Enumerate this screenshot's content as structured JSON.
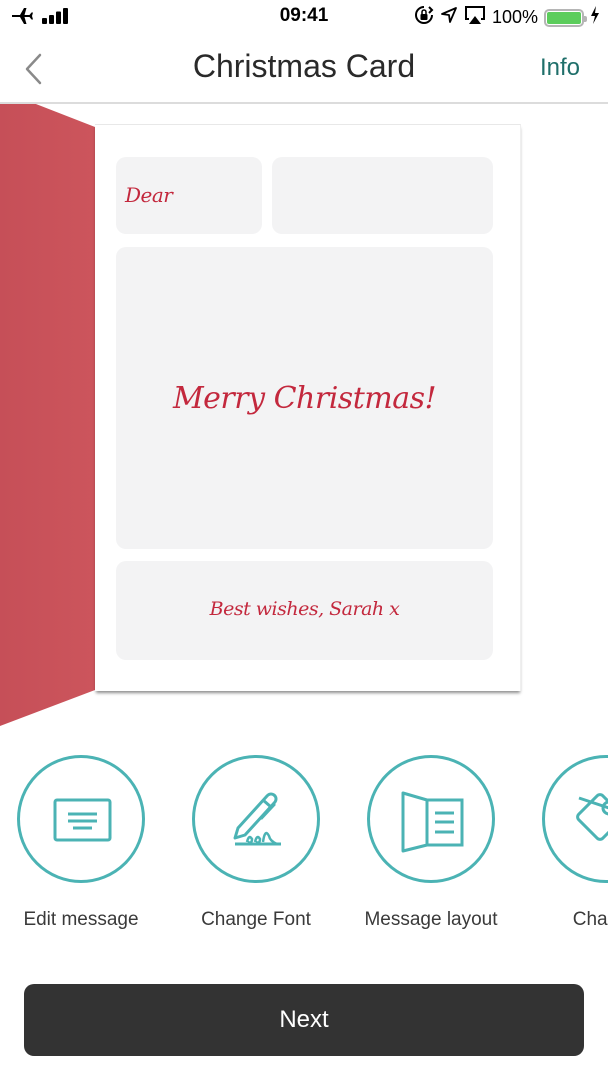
{
  "status_bar": {
    "time": "09:41",
    "battery_percent": "100%",
    "battery_level": 1.0,
    "icons": [
      "airplane-mode-icon",
      "signal-icon",
      "orientation-lock-icon",
      "location-icon",
      "airplay-icon",
      "battery-icon",
      "charging-icon"
    ]
  },
  "nav": {
    "title": "Christmas Card",
    "back_icon": "chevron-left-icon",
    "info_label": "Info"
  },
  "card": {
    "cover_color": "#c9525a",
    "text_color": "#c3283d",
    "box_color": "#f3f3f4",
    "dear_text": "Dear",
    "name_text": "",
    "message_text": "Merry Christmas!",
    "signoff_text": "Best wishes, Sarah x"
  },
  "actions": [
    {
      "label": "Edit message",
      "icon": "edit-message-icon"
    },
    {
      "label": "Change Font",
      "icon": "pen-signature-icon"
    },
    {
      "label": "Message layout",
      "icon": "card-layout-icon"
    },
    {
      "label": "Change",
      "icon": "tag-icon"
    }
  ],
  "accent_color": "#4bb3b4",
  "next_button": {
    "label": "Next"
  }
}
